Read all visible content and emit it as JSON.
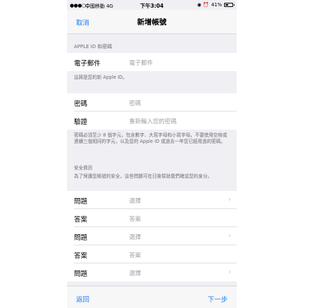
{
  "status_bar": {
    "signal": "●●●○○",
    "carrier": "中國移動  4G",
    "time": "下午3:04",
    "right_icons": "◉ ⏰",
    "battery": "41%",
    "battery_level": 0.41
  },
  "nav": {
    "cancel": "取消",
    "title": "新增帳號"
  },
  "apple_id_section": {
    "header": "APPLE ID 和密碼",
    "email_label": "電子郵件",
    "email_placeholder": "電子郵件",
    "note": "這將是您的新 Apple ID。"
  },
  "password_section": {
    "password_label": "密碼",
    "password_placeholder": "密碼",
    "verify_label": "驗證",
    "verify_placeholder": "重新輸入您的密碼",
    "note": "密碼必須至少 8 個字元，包含數字、大寫字母和小寫字母。不要使用空格或連續三個相同的字元，以及您的 Apple ID 或過去一年您已經用過的密碼。"
  },
  "security_section": {
    "title": "安全資訊",
    "description": "為了保護您帳號的安全，這些問題可在日後幫助我們確認您的身分。",
    "rows": [
      {
        "label": "問題",
        "value": "選擇",
        "chevron": "›"
      },
      {
        "label": "答案",
        "value": "答案",
        "chevron": ""
      },
      {
        "label": "問題",
        "value": "選擇",
        "chevron": "›"
      },
      {
        "label": "答案",
        "value": "答案",
        "chevron": ""
      },
      {
        "label": "問題",
        "value": "選擇",
        "chevron": "›"
      }
    ]
  },
  "toolbar": {
    "back": "返回",
    "next": "下一步"
  }
}
